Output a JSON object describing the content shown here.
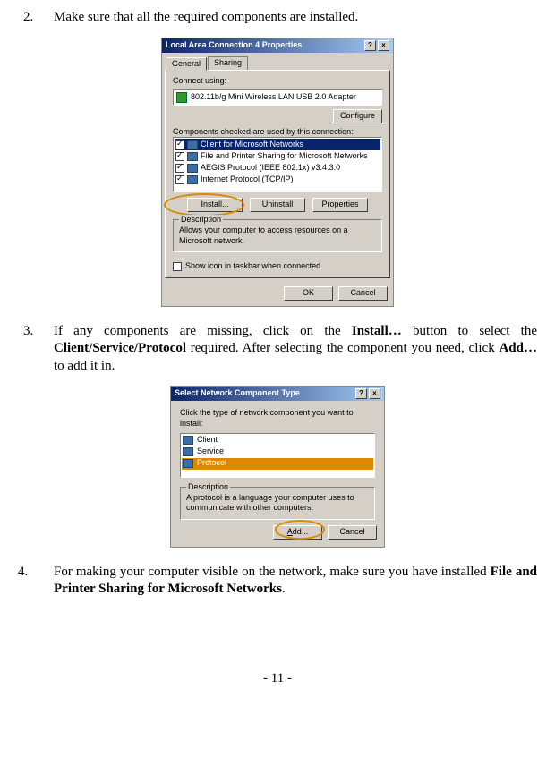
{
  "steps": [
    {
      "num": "2.",
      "text": "Make sure that all the required components are installed."
    },
    {
      "num": "3.",
      "parts": [
        "If any components are missing, click on the ",
        "Install…",
        " button to select the ",
        "Client/Service/Protocol",
        " required. After selecting the component you need, click ",
        "Add…",
        " to add it in."
      ]
    },
    {
      "num": "4.",
      "parts": [
        "For making your computer visible on the network, make sure you have installed ",
        "File and Printer Sharing for Microsoft Networks",
        "."
      ]
    }
  ],
  "dialog1": {
    "title": "Local Area Connection 4 Properties",
    "help_btn": "?",
    "close_btn": "×",
    "tabs": [
      "General",
      "Sharing"
    ],
    "connect_label": "Connect using:",
    "adapter": "802.11b/g Mini Wireless LAN USB 2.0 Adapter",
    "configure_btn": "Configure",
    "components_label": "Components checked are used by this connection:",
    "items": [
      "Client for Microsoft Networks",
      "File and Printer Sharing for Microsoft Networks",
      "AEGIS Protocol (IEEE 802.1x) v3.4.3.0",
      "Internet Protocol (TCP/IP)"
    ],
    "install_btn": "Install...",
    "uninstall_btn": "Uninstall",
    "properties_btn": "Properties",
    "desc_label": "Description",
    "desc_text": "Allows your computer to access resources on a Microsoft network.",
    "show_icon": "Show icon in taskbar when connected",
    "ok_btn": "OK",
    "cancel_btn": "Cancel"
  },
  "dialog2": {
    "title": "Select Network Component Type",
    "help_btn": "?",
    "close_btn": "×",
    "instruction": "Click the type of network component you want to install:",
    "items": [
      "Client",
      "Service",
      "Protocol"
    ],
    "desc_label": "Description",
    "desc_text": "A protocol is a language your computer uses to communicate with other computers.",
    "add_btn": "Add...",
    "cancel_btn": "Cancel"
  },
  "page_number": "- 11 -"
}
